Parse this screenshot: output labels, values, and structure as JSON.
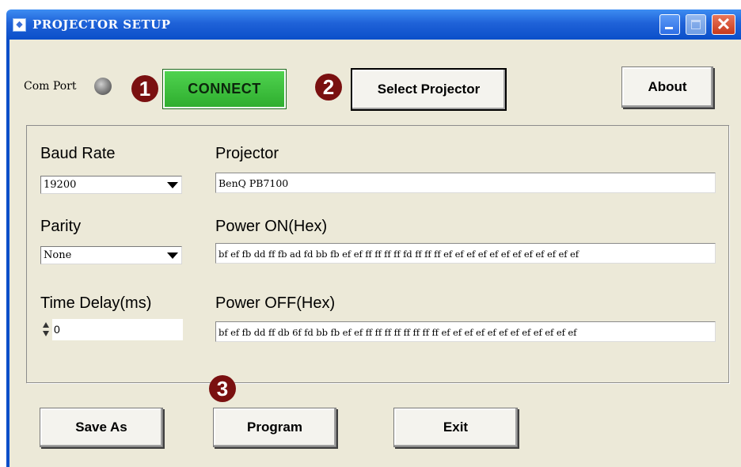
{
  "window": {
    "title": "PROJECTOR SETUP"
  },
  "toolbar": {
    "com_port_label": "Com Port",
    "connect_label": "CONNECT",
    "select_projector_label": "Select Projector",
    "about_label": "About",
    "step1": "1",
    "step2": "2"
  },
  "settings": {
    "baud_rate_label": "Baud Rate",
    "baud_rate_value": "19200",
    "parity_label": "Parity",
    "parity_value": "None",
    "time_delay_label": "Time Delay(ms)",
    "time_delay_value": "0",
    "projector_label": "Projector",
    "projector_value": "BenQ  PB7100",
    "power_on_label": "Power ON(Hex)",
    "power_on_value": "bf ef fb dd ff fb ad fd bb fb ef ef ff ff ff ff fd ff ff ff ef ef ef ef ef ef ef ef ef ef ef ef",
    "power_off_label": "Power OFF(Hex)",
    "power_off_value": "bf ef fb dd ff db 6f fd bb fb ef ef ff ff ff ff ff ff ff ff ef ef ef ef ef ef ef ef ef ef ef ef"
  },
  "footer": {
    "save_as_label": "Save As",
    "program_label": "Program",
    "exit_label": "Exit",
    "step3": "3"
  },
  "colors": {
    "title_bar": "#0b4fc9",
    "client_bg": "#ece9d8",
    "connect_green": "#2fae2f",
    "step_badge": "#7a1010",
    "close_button": "#c7391c"
  }
}
